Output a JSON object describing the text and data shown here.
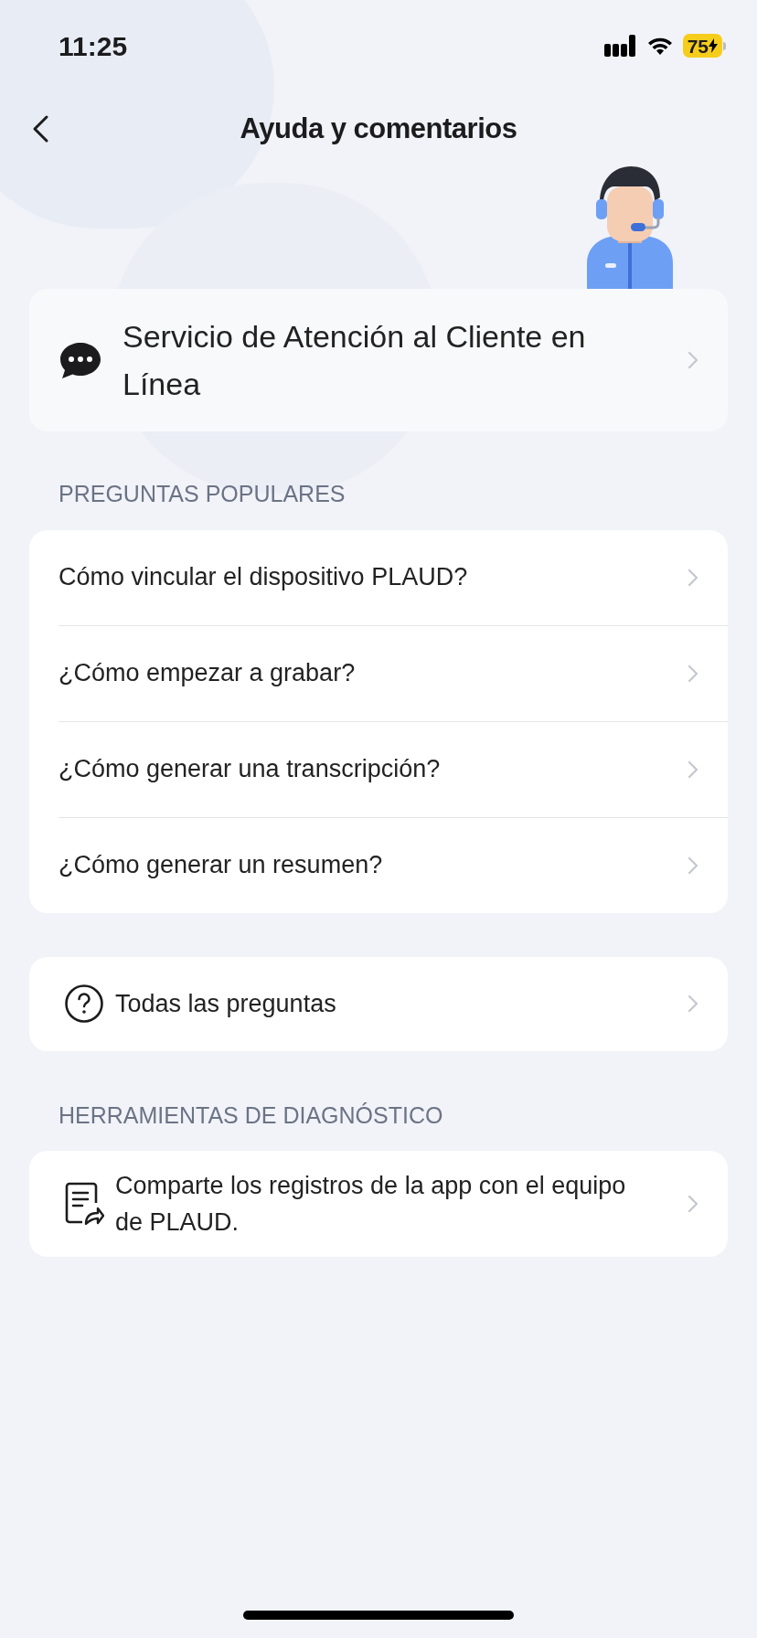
{
  "status_bar": {
    "time": "11:25",
    "battery": "75"
  },
  "header": {
    "title": "Ayuda y comentarios"
  },
  "support_card": {
    "label": "Servicio de Atención al Cliente en Línea"
  },
  "popular_questions": {
    "heading": "PREGUNTAS POPULARES",
    "items": [
      {
        "label": "Cómo vincular el dispositivo PLAUD?"
      },
      {
        "label": "¿Cómo empezar a grabar?"
      },
      {
        "label": "¿Cómo generar una transcripción?"
      },
      {
        "label": "¿Cómo generar un resumen?"
      }
    ]
  },
  "all_questions": {
    "label": "Todas las preguntas"
  },
  "diagnostics": {
    "heading": "HERRAMIENTAS DE DIAGNÓSTICO",
    "items": [
      {
        "label": "Comparte los registros de la app con el equipo de PLAUD."
      }
    ]
  }
}
